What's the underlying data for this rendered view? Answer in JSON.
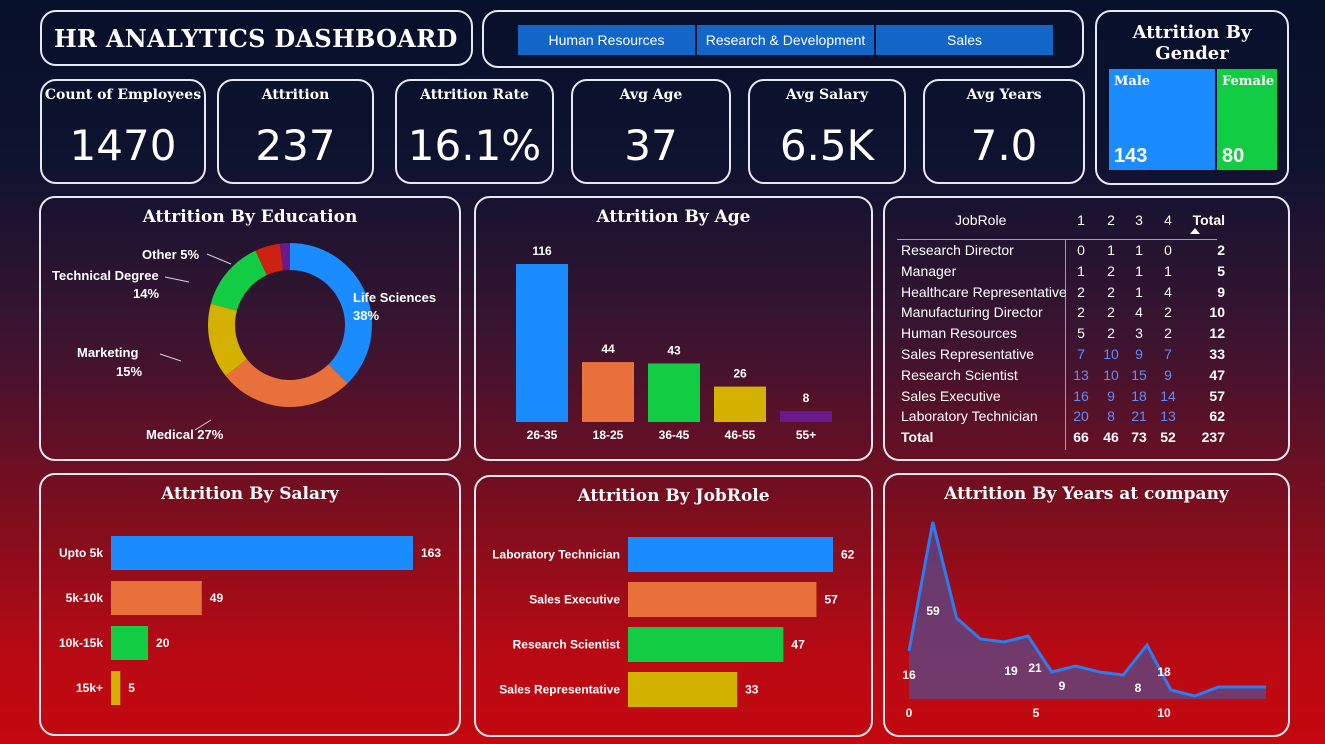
{
  "header": {
    "title": "HR ANALYTICS DASHBOARD"
  },
  "slicer": {
    "options": [
      "Human Resources",
      "Research & Development",
      "Sales"
    ]
  },
  "kpis": [
    {
      "label": "Count of Employees",
      "value": "1470"
    },
    {
      "label": "Attrition",
      "value": "237"
    },
    {
      "label": "Attrition Rate",
      "value": "16.1%"
    },
    {
      "label": "Avg Age",
      "value": "37"
    },
    {
      "label": "Avg Salary",
      "value": "6.5K"
    },
    {
      "label": "Avg Years",
      "value": "7.0"
    }
  ],
  "gender": {
    "title": "Attrition By Gender",
    "male_label": "Male",
    "male_value": "143",
    "female_label": "Female",
    "female_value": "80",
    "colors": {
      "male": "#1a8cff",
      "female": "#12cc44"
    }
  },
  "table": {
    "headers": [
      "JobRole",
      "1",
      "2",
      "3",
      "4",
      "Total"
    ],
    "rows": [
      {
        "role": "Research Director",
        "v": [
          "0",
          "1",
          "1",
          "0"
        ],
        "total": "2"
      },
      {
        "role": "Manager",
        "v": [
          "1",
          "2",
          "1",
          "1"
        ],
        "total": "5"
      },
      {
        "role": "Healthcare Representative",
        "v": [
          "2",
          "2",
          "1",
          "4"
        ],
        "total": "9"
      },
      {
        "role": "Manufacturing Director",
        "v": [
          "2",
          "2",
          "4",
          "2"
        ],
        "total": "10"
      },
      {
        "role": "Human Resources",
        "v": [
          "5",
          "2",
          "3",
          "2"
        ],
        "total": "12"
      },
      {
        "role": "Sales Representative",
        "v": [
          "7",
          "10",
          "9",
          "7"
        ],
        "total": "33"
      },
      {
        "role": "Research Scientist",
        "v": [
          "13",
          "10",
          "15",
          "9"
        ],
        "total": "47"
      },
      {
        "role": "Sales Executive",
        "v": [
          "16",
          "9",
          "18",
          "14"
        ],
        "total": "57"
      },
      {
        "role": "Laboratory Technician",
        "v": [
          "20",
          "8",
          "21",
          "13"
        ],
        "total": "62"
      }
    ],
    "total_row": {
      "role": "Total",
      "v": [
        "66",
        "46",
        "73",
        "52"
      ],
      "total": "237"
    }
  },
  "chart_data": [
    {
      "id": "education",
      "type": "pie",
      "title": "Attrition By Education",
      "slices": [
        {
          "label": "Life Sciences",
          "pct_label": "38%",
          "value": 38,
          "color": "#1a8cff"
        },
        {
          "label": "Medical",
          "pct_label": "27%",
          "value": 27,
          "color": "#e8703a"
        },
        {
          "label": "Marketing",
          "pct_label": "15%",
          "value": 15,
          "color": "#d4b000"
        },
        {
          "label": "Technical Degree",
          "pct_label": "14%",
          "value": 14,
          "color": "#12cc44"
        },
        {
          "label": "Other",
          "pct_label": "5%",
          "value": 5,
          "color": "#cc2211"
        },
        {
          "label": "",
          "pct_label": "",
          "value": 2,
          "color": "#6a1a8a"
        }
      ]
    },
    {
      "id": "age",
      "type": "bar",
      "title": "Attrition By Age",
      "categories": [
        "26-35",
        "18-25",
        "36-45",
        "46-55",
        "55+"
      ],
      "values": [
        116,
        44,
        43,
        26,
        8
      ],
      "colors": [
        "#1a8cff",
        "#e8703a",
        "#12cc44",
        "#d4b000",
        "#6a1a8a"
      ]
    },
    {
      "id": "salary",
      "type": "bar",
      "orientation": "horizontal",
      "title": "Attrition By Salary",
      "categories": [
        "Upto 5k",
        "5k-10k",
        "10k-15k",
        "15k+"
      ],
      "values": [
        163,
        49,
        20,
        5
      ],
      "colors": [
        "#1a8cff",
        "#e8703a",
        "#12cc44",
        "#d4b000"
      ]
    },
    {
      "id": "jobrole",
      "type": "bar",
      "orientation": "horizontal",
      "title": "Attrition By JobRole",
      "categories": [
        "Laboratory Technician",
        "Sales Executive",
        "Research Scientist",
        "Sales Representative"
      ],
      "values": [
        62,
        57,
        47,
        33
      ],
      "colors": [
        "#1a8cff",
        "#e8703a",
        "#12cc44",
        "#d4b000"
      ]
    },
    {
      "id": "years",
      "type": "area",
      "title": "Attrition By Years at company",
      "x": [
        0,
        1,
        2,
        3,
        4,
        5,
        6,
        7,
        8,
        9,
        10,
        11,
        12,
        13,
        14,
        15
      ],
      "y": [
        16,
        59,
        27,
        20,
        19,
        21,
        9,
        11,
        9,
        8,
        18,
        3,
        1,
        4,
        4,
        4
      ],
      "labeled_points": [
        0,
        2,
        4,
        5,
        6,
        9,
        10
      ],
      "labels": {
        "0": "16",
        "2": "59",
        "4": "19",
        "5": "21",
        "6": "9",
        "9": "8",
        "10": "18"
      },
      "x_ticks": [
        "0",
        "5",
        "10"
      ],
      "color": "#2a7cf0"
    }
  ]
}
